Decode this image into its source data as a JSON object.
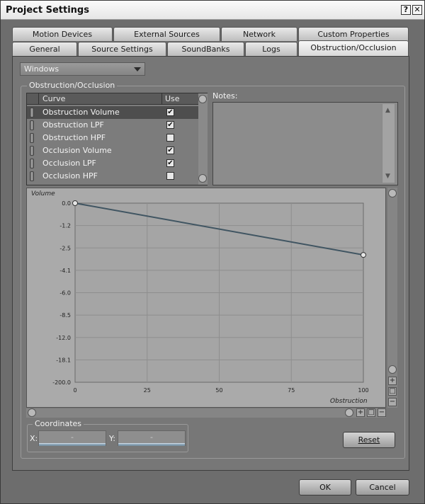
{
  "window": {
    "title": "Project Settings",
    "help_label": "?",
    "close_label": "✕"
  },
  "tabs_row1": [
    {
      "label": "Motion Devices"
    },
    {
      "label": "External Sources"
    },
    {
      "label": "Network"
    },
    {
      "label": "Custom Properties"
    }
  ],
  "tabs_row2": [
    {
      "label": "General"
    },
    {
      "label": "Source Settings"
    },
    {
      "label": "SoundBanks"
    },
    {
      "label": "Logs"
    },
    {
      "label": "Obstruction/Occlusion",
      "active": true
    }
  ],
  "platform_select": {
    "value": "Windows"
  },
  "group": {
    "label": "Obstruction/Occlusion"
  },
  "curve_list": {
    "headers": {
      "curve": "Curve",
      "use": "Use"
    },
    "rows": [
      {
        "name": "Obstruction Volume",
        "checked": "✔",
        "selected": true
      },
      {
        "name": "Obstruction LPF",
        "checked": "✔"
      },
      {
        "name": "Obstruction HPF",
        "checked": ""
      },
      {
        "name": "Occlusion Volume",
        "checked": "✔"
      },
      {
        "name": "Occlusion LPF",
        "checked": "✔"
      },
      {
        "name": "Occlusion HPF",
        "checked": ""
      }
    ]
  },
  "notes": {
    "label": "Notes:",
    "value": ""
  },
  "graph": {
    "ylabel": "Volume",
    "xlabel": "Obstruction",
    "line_color": "#405562"
  },
  "chart_data": {
    "type": "line",
    "title": "",
    "xlabel": "Obstruction",
    "ylabel": "Volume",
    "x_ticks": [
      "0",
      "25",
      "50",
      "75",
      "100"
    ],
    "y_ticks": [
      "0.0",
      "-1.2",
      "-2.5",
      "-4.1",
      "-6.0",
      "-8.5",
      "-12.0",
      "-18.1",
      "-200.0"
    ],
    "xlim": [
      0,
      100
    ],
    "grid": true,
    "series": [
      {
        "points": [
          {
            "x": 0,
            "y": 0.0
          },
          {
            "x": 100,
            "y": -3.0
          }
        ]
      }
    ]
  },
  "coordinates": {
    "label": "Coordinates",
    "x_label": "X:",
    "y_label": "Y:",
    "x_value": "-",
    "y_value": "-"
  },
  "buttons": {
    "reset": "Reset",
    "ok": "OK",
    "cancel": "Cancel"
  },
  "graph_controls": {
    "plus": "+",
    "fit": "□",
    "minus": "−"
  }
}
